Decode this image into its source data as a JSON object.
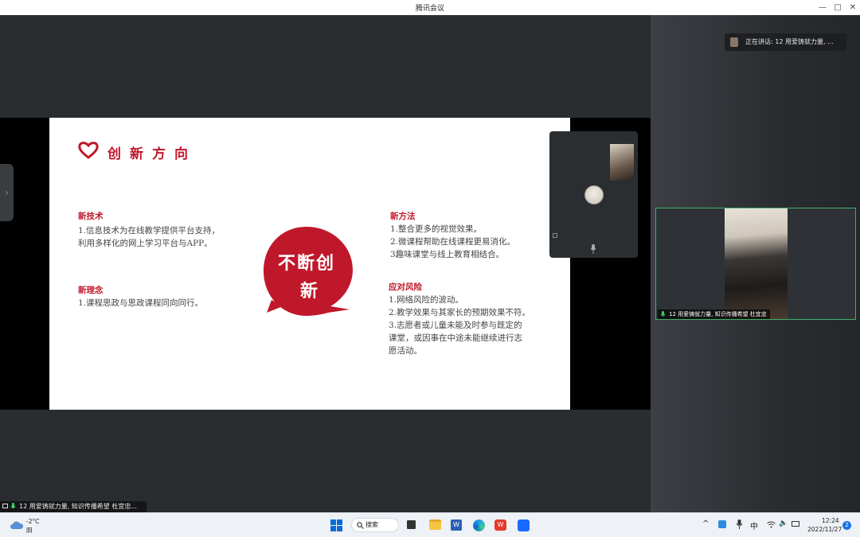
{
  "window": {
    "title": "腾讯会议",
    "minimize": "—",
    "maximize": "□",
    "close": "✕"
  },
  "slide": {
    "heading": "创新方向",
    "center_text_1": "不断创",
    "center_text_2": "新",
    "sections": [
      {
        "title": "新技术",
        "lines": [
          "1.信息技术为在线教学提供平台支持，",
          "利用多样化的网上学习平台与APP。"
        ]
      },
      {
        "title": "新理念",
        "lines": [
          "1.课程思政与思政课程同向同行。"
        ]
      },
      {
        "title": "新方法",
        "lines": [
          "1.整合更多的视觉效果。",
          "2.微课程帮助在线课程更易消化。",
          "3趣味课堂与线上教育相结合。"
        ]
      },
      {
        "title": "应对风险",
        "lines": [
          "1.网络风险的波动。",
          "2.教学效果与其家长的预期效果不符。",
          "3.志愿者或儿童未能及时参与既定的",
          "课堂，或因事在中途未能继续进行志",
          "愿活动。"
        ]
      }
    ],
    "accent_color": "#c0182b"
  },
  "speaking": {
    "text": "正在讲话: 12 用爱铸就力量, ..."
  },
  "video_tile": {
    "label": "12 用爱铸就力量, 知识传播希望 杜宜忠"
  },
  "bottom_left": {
    "label": "12 用爱铸就力量, 知识传播希望 杜宜忠..."
  },
  "taskbar": {
    "weather_temp": "-2°C",
    "weather_desc": "阴",
    "search_label": "搜索",
    "ime": "中",
    "time": "12:24",
    "date": "2022/11/27",
    "notification_count": "2"
  }
}
